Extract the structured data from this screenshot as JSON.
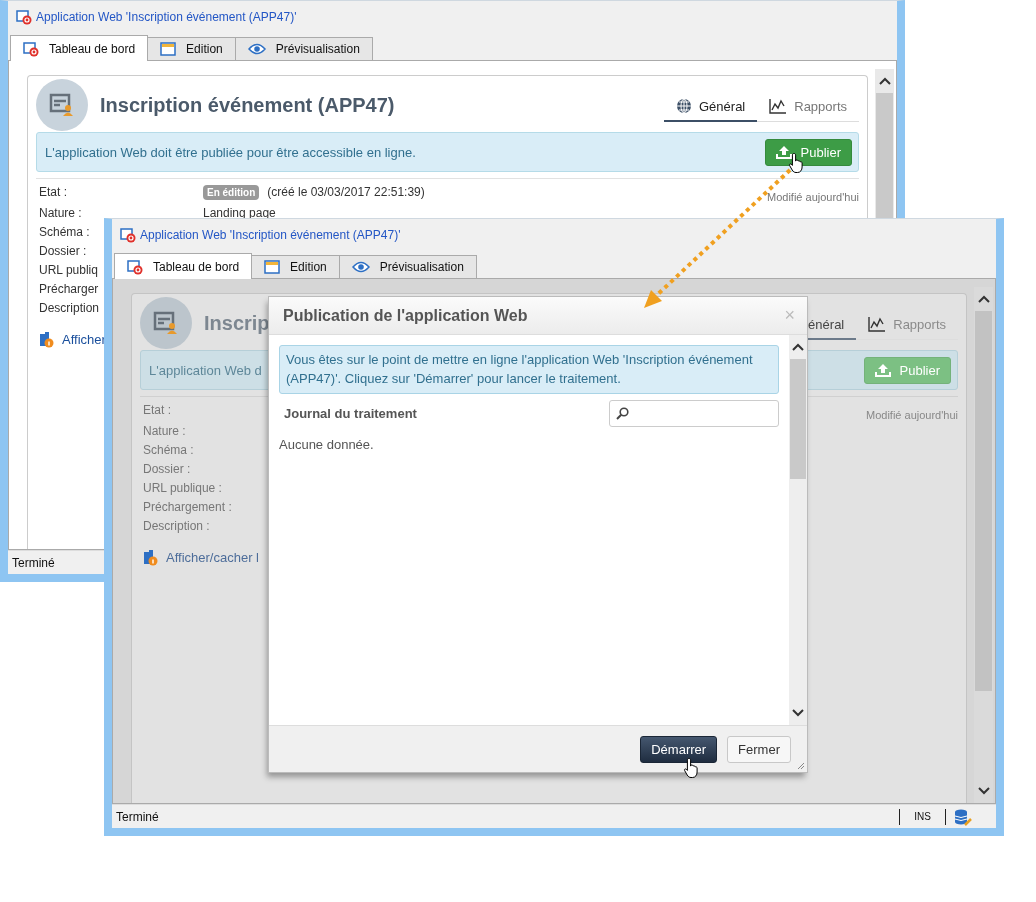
{
  "windows": [
    {
      "title": "Application Web 'Inscription événement (APP47)'",
      "dimmed": false,
      "tabs": [
        {
          "label": "Tableau de bord",
          "kind": "app",
          "selected": true
        },
        {
          "label": "Edition",
          "kind": "edit",
          "selected": false
        },
        {
          "label": "Prévisualisation",
          "kind": "eye",
          "selected": false
        }
      ],
      "heading": "Inscription événement (APP47)",
      "view_tabs": [
        {
          "label": "Général",
          "kind": "globe",
          "selected": true
        },
        {
          "label": "Rapports",
          "kind": "chart",
          "selected": false
        }
      ],
      "banner": "L'application Web doit être publiée pour être accessible en ligne.",
      "publish_button": "Publier",
      "fields": [
        {
          "label": "Etat :",
          "badge": "En édition",
          "value": "(créé le 03/03/2017 22:51:39)"
        },
        {
          "label": "Nature :",
          "value": "Landing page"
        },
        {
          "label": "Schéma :"
        },
        {
          "label": "Dossier :"
        },
        {
          "label": "URL publiq"
        },
        {
          "label": "Précharger"
        },
        {
          "label": "Description"
        }
      ],
      "modified": "Modifié aujourd'hui",
      "toggle_link": "Afficher",
      "status": {
        "text": "Terminé"
      }
    },
    {
      "title": "Application Web 'Inscription événement (APP47)'",
      "dimmed": true,
      "tabs": [
        {
          "label": "Tableau de bord",
          "kind": "app",
          "selected": true
        },
        {
          "label": "Edition",
          "kind": "edit",
          "selected": false
        },
        {
          "label": "Prévisualisation",
          "kind": "eye",
          "selected": false
        }
      ],
      "heading": "Inscrip",
      "view_tabs": [
        {
          "label": "énéral",
          "kind": "plain",
          "selected": true
        },
        {
          "label": "Rapports",
          "kind": "chart",
          "selected": false
        }
      ],
      "banner": "L'application Web d",
      "publish_button": "Publier",
      "fields": [
        {
          "label": "Etat :"
        },
        {
          "label": "Nature :"
        },
        {
          "label": "Schéma :"
        },
        {
          "label": "Dossier :"
        },
        {
          "label": "URL publique :"
        },
        {
          "label": "Préchargement :"
        },
        {
          "label": "Description :"
        }
      ],
      "modified": "Modifié aujourd'hui",
      "toggle_link": "Afficher/cacher l",
      "status": {
        "text": "Terminé",
        "mode": "INS"
      }
    }
  ],
  "dialog": {
    "title": "Publication de l'application Web",
    "close": "×",
    "message": "Vous êtes sur le point de mettre en ligne l'application Web 'Inscription événement (APP47)'. Cliquez sur 'Démarrer' pour lancer le traitement.",
    "log_label": "Journal du traitement",
    "empty_text": "Aucune donnée.",
    "buttons": [
      {
        "label": "Démarrer",
        "kind": "primary"
      },
      {
        "label": "Fermer",
        "kind": "default"
      }
    ]
  }
}
